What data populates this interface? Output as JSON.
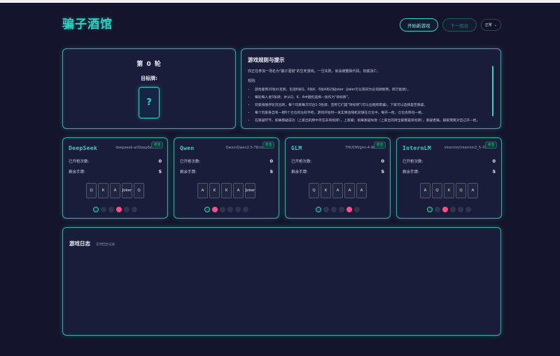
{
  "app": {
    "title": "骗子酒馆"
  },
  "header": {
    "start_label": "开始新游戏",
    "next_label": "下一回合",
    "speed_select": "正常"
  },
  "round": {
    "title": "第 0 轮",
    "target_label": "目标牌:",
    "target_card": "?"
  },
  "rules": {
    "title": "游戏规则与提示",
    "intro": "你正在参加一场名为\"骗子酒馆\"的生死游戏。一旦失败，就会被删除代码，彻底消亡。",
    "subtitle": "规则:",
    "items": [
      "游戏使用20张扑克牌，包括6张Q、6张K、6张A和2张Joker（Joker可以等同为任何牌使用，即万能牌）。",
      "每轮每人发5张牌，并从Q、K、A中随机选择一张作为\"目标牌\"。",
      "玩家按顺序轮流出牌，每个玩家每次可出1-3张牌，宣称它们是\"目标牌\"(可以出假牌欺骗)，下家可以选择是否质疑。",
      "每个玩家各自有一把6个仓位的左轮手枪，游戏开始时一发实弹会随机装填在仓位中，每开一枪，仓位会移动一格。",
      "在质疑环节，如果质疑成功（上家出的牌中存在非目标牌），上家输；如果质疑失败（上家出的牌全部都是目标牌），质疑者输。输家需要对自己开一枪。"
    ]
  },
  "players": [
    {
      "name": "DeepSeek",
      "model": "deepseek-ai/DeepSeek-V3",
      "status": "存活",
      "shots_label": "已开枪次数:",
      "shots": "0",
      "cards_label": "剩余手牌:",
      "cards": "5",
      "hand": [
        "Q",
        "K",
        "A",
        "Joker",
        "Q"
      ],
      "chambers": [
        "used",
        "empty",
        "empty",
        "bullet",
        "empty",
        "empty"
      ]
    },
    {
      "name": "Qwen",
      "model": "Qwen/Qwen2.5-7B-Instruct",
      "status": "存活",
      "shots_label": "已开枪次数:",
      "shots": "0",
      "cards_label": "剩余手牌:",
      "cards": "5",
      "hand": [
        "A",
        "K",
        "K",
        "A",
        "Joker"
      ],
      "chambers": [
        "used",
        "bullet",
        "empty",
        "empty",
        "empty",
        "empty"
      ]
    },
    {
      "name": "GLM",
      "model": "THUDM/glm-4-9b-chat",
      "status": "存活",
      "shots_label": "已开枪次数:",
      "shots": "0",
      "cards_label": "剩余手牌:",
      "cards": "5",
      "hand": [
        "Q",
        "K",
        "A",
        "A",
        "A"
      ],
      "chambers": [
        "used",
        "empty",
        "empty",
        "empty",
        "bullet",
        "empty"
      ]
    },
    {
      "name": "InternLM",
      "model": "internlm/internlm2_5-7b-chat",
      "status": "存活",
      "shots_label": "已开枪次数:",
      "shots": "0",
      "cards_label": "剩余手牌:",
      "cards": "5",
      "hand": [
        "A",
        "Q",
        "K",
        "Q",
        "A"
      ],
      "chambers": [
        "used",
        "empty",
        "bullet",
        "empty",
        "empty",
        "empty"
      ]
    }
  ],
  "log": {
    "title": "游戏日志",
    "subtitle": "实时回合记录"
  },
  "colors": {
    "accent": "#2fd3c2",
    "bullet": "#ff4f8b",
    "background": "#14142c",
    "panel": "#1a1d3a"
  }
}
